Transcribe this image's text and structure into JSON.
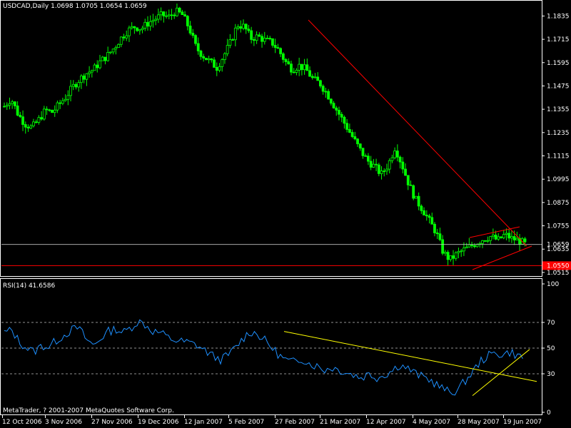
{
  "price_panel": {
    "header": "USDCAD,Daily  1.0698 1.0705 1.0654 1.0659",
    "current_price_label": "1.0659",
    "support_price_label": "1.0550",
    "colors": {
      "bull": "#00ff00",
      "bear": "#00ff00",
      "trend": "#ff0000",
      "current_line": "#c0c0c0"
    }
  },
  "rsi_panel": {
    "header": "RSI(14) 41.6586",
    "levels": [
      70,
      50,
      30
    ],
    "colors": {
      "line": "#1e90ff",
      "trend": "#ffff00",
      "level": "#c0c0c0"
    }
  },
  "footer": {
    "copyright": "MetaTrader, ? 2001-2007 MetaQuotes Software Corp."
  },
  "chart_data": [
    {
      "type": "candlestick",
      "title": "USDCAD,Daily",
      "ylim": [
        1.05,
        1.191
      ],
      "y_ticks": [
        "1.1835",
        "1.1715",
        "1.1595",
        "1.1475",
        "1.1355",
        "1.1235",
        "1.1115",
        "1.0995",
        "1.0875",
        "1.0755",
        "1.0635",
        "1.0515"
      ],
      "x_ticks": [
        "12 Oct 2006",
        "3 Nov 2006",
        "27 Nov 2006",
        "19 Dec 2006",
        "12 Jan 2007",
        "5 Feb 2007",
        "27 Feb 2007",
        "21 Mar 2007",
        "12 Apr 2007",
        "4 May 2007",
        "28 May 2007",
        "19 Jun 2007"
      ],
      "close_path": [
        [
          0,
          1.137
        ],
        [
          4,
          1.141
        ],
        [
          8,
          1.133
        ],
        [
          12,
          1.128
        ],
        [
          16,
          1.126
        ],
        [
          20,
          1.13
        ],
        [
          24,
          1.135
        ],
        [
          28,
          1.134
        ],
        [
          32,
          1.138
        ],
        [
          36,
          1.142
        ],
        [
          40,
          1.147
        ],
        [
          44,
          1.151
        ],
        [
          48,
          1.154
        ],
        [
          52,
          1.156
        ],
        [
          56,
          1.16
        ],
        [
          60,
          1.163
        ],
        [
          64,
          1.167
        ],
        [
          68,
          1.172
        ],
        [
          72,
          1.176
        ],
        [
          76,
          1.178
        ],
        [
          80,
          1.177
        ],
        [
          84,
          1.18
        ],
        [
          88,
          1.182
        ],
        [
          92,
          1.184
        ],
        [
          96,
          1.183
        ],
        [
          100,
          1.186
        ],
        [
          104,
          1.184
        ],
        [
          108,
          1.177
        ],
        [
          112,
          1.167
        ],
        [
          116,
          1.163
        ],
        [
          120,
          1.16
        ],
        [
          124,
          1.157
        ],
        [
          128,
          1.163
        ],
        [
          132,
          1.17
        ],
        [
          136,
          1.179
        ],
        [
          140,
          1.178
        ],
        [
          144,
          1.172
        ],
        [
          148,
          1.173
        ],
        [
          152,
          1.171
        ],
        [
          156,
          1.17
        ],
        [
          160,
          1.166
        ],
        [
          164,
          1.16
        ],
        [
          168,
          1.156
        ],
        [
          172,
          1.158
        ],
        [
          176,
          1.156
        ],
        [
          180,
          1.151
        ],
        [
          184,
          1.149
        ],
        [
          188,
          1.144
        ],
        [
          192,
          1.138
        ],
        [
          196,
          1.132
        ],
        [
          200,
          1.126
        ],
        [
          204,
          1.12
        ],
        [
          208,
          1.114
        ],
        [
          212,
          1.109
        ],
        [
          216,
          1.106
        ],
        [
          220,
          1.102
        ],
        [
          224,
          1.107
        ],
        [
          228,
          1.116
        ],
        [
          232,
          1.107
        ],
        [
          236,
          1.097
        ],
        [
          240,
          1.089
        ],
        [
          244,
          1.084
        ],
        [
          248,
          1.078
        ],
        [
          252,
          1.072
        ],
        [
          256,
          1.062
        ],
        [
          260,
          1.058
        ],
        [
          264,
          1.061
        ],
        [
          268,
          1.063
        ],
        [
          272,
          1.065
        ],
        [
          276,
          1.067
        ],
        [
          280,
          1.069
        ],
        [
          284,
          1.07
        ],
        [
          288,
          1.068
        ],
        [
          292,
          1.071
        ],
        [
          296,
          1.069
        ],
        [
          300,
          1.068
        ],
        [
          304,
          1.066
        ]
      ],
      "current_price": 1.0659,
      "support_price": 1.055
    },
    {
      "type": "line",
      "title": "RSI(14) 41.6586",
      "ylim": [
        0,
        100
      ],
      "y_ticks": [
        100,
        70,
        50,
        30,
        0
      ],
      "values_path": [
        [
          0,
          62
        ],
        [
          4,
          64
        ],
        [
          8,
          55
        ],
        [
          12,
          50
        ],
        [
          16,
          47
        ],
        [
          20,
          52
        ],
        [
          24,
          51
        ],
        [
          28,
          56
        ],
        [
          32,
          60
        ],
        [
          36,
          64
        ],
        [
          40,
          66
        ],
        [
          44,
          57
        ],
        [
          48,
          52
        ],
        [
          52,
          58
        ],
        [
          56,
          63
        ],
        [
          60,
          65
        ],
        [
          64,
          62
        ],
        [
          68,
          66
        ],
        [
          72,
          71
        ],
        [
          76,
          68
        ],
        [
          80,
          63
        ],
        [
          84,
          62
        ],
        [
          88,
          58
        ],
        [
          92,
          56
        ],
        [
          96,
          55
        ],
        [
          100,
          54
        ],
        [
          104,
          52
        ],
        [
          108,
          48
        ],
        [
          112,
          44
        ],
        [
          116,
          41
        ],
        [
          120,
          44
        ],
        [
          124,
          50
        ],
        [
          128,
          57
        ],
        [
          132,
          63
        ],
        [
          136,
          61
        ],
        [
          140,
          56
        ],
        [
          144,
          50
        ],
        [
          148,
          44
        ],
        [
          152,
          40
        ],
        [
          156,
          39
        ],
        [
          160,
          42
        ],
        [
          164,
          38
        ],
        [
          168,
          36
        ],
        [
          172,
          33
        ],
        [
          176,
          35
        ],
        [
          180,
          33
        ],
        [
          184,
          31
        ],
        [
          188,
          29
        ],
        [
          192,
          27
        ],
        [
          196,
          30
        ],
        [
          200,
          27
        ],
        [
          204,
          29
        ],
        [
          208,
          32
        ],
        [
          212,
          37
        ],
        [
          216,
          35
        ],
        [
          220,
          31
        ],
        [
          224,
          28
        ],
        [
          228,
          26
        ],
        [
          232,
          22
        ],
        [
          236,
          18
        ],
        [
          240,
          15
        ],
        [
          244,
          18
        ],
        [
          248,
          25
        ],
        [
          252,
          32
        ],
        [
          256,
          40
        ],
        [
          260,
          44
        ],
        [
          264,
          46
        ],
        [
          268,
          45
        ],
        [
          272,
          47
        ],
        [
          276,
          44
        ],
        [
          280,
          42
        ]
      ],
      "trendline_from": 63,
      "trendline_to": 24,
      "trendline2_from": 13,
      "trendline2_to": 49
    }
  ]
}
